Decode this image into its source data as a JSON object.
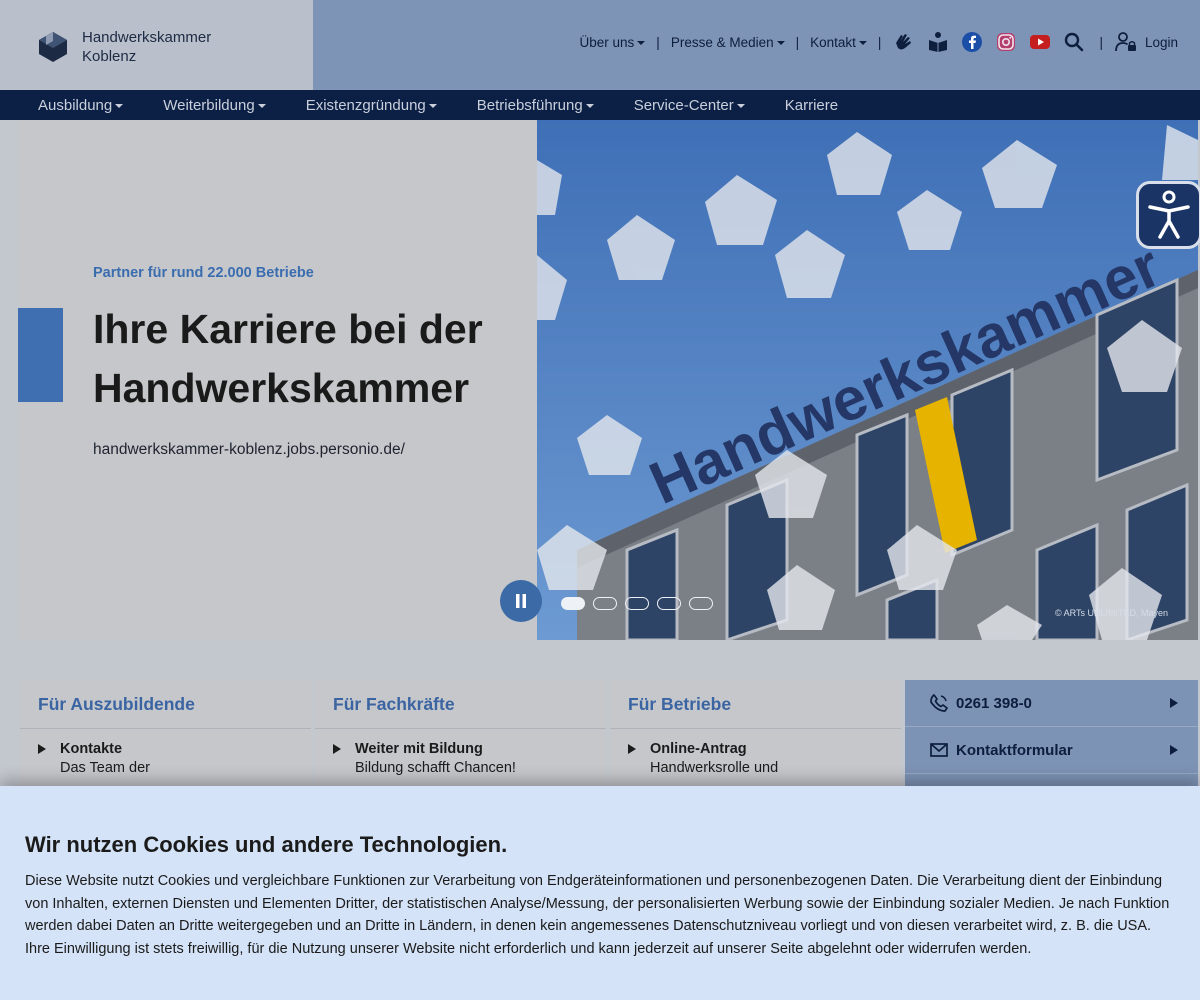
{
  "brand": {
    "name_line1": "Handwerkskammer",
    "name_line2": "Koblenz"
  },
  "meta_nav": {
    "items": [
      {
        "label": "Über uns"
      },
      {
        "label": "Presse & Medien"
      },
      {
        "label": "Kontakt"
      }
    ],
    "icons": [
      "sign-language-icon",
      "easy-language-icon",
      "facebook-icon",
      "instagram-icon",
      "youtube-icon",
      "search-icon"
    ],
    "login_label": "Login"
  },
  "main_nav": {
    "items": [
      {
        "label": "Ausbildung"
      },
      {
        "label": "Weiterbildung"
      },
      {
        "label": "Existenzgründung"
      },
      {
        "label": "Betriebsführung"
      },
      {
        "label": "Service-Center"
      },
      {
        "label": "Karriere"
      }
    ]
  },
  "hero": {
    "kicker": "Partner für rund 22.000 Betriebe",
    "headline": "Ihre Karriere bei der Handwerkskammer",
    "link": "handwerkskammer-koblenz.jobs.personio.de/",
    "image_sign_text": "Handwerkskammer",
    "copyright": "© ARTs UNLIMITED, Mayen",
    "slides_total": 5,
    "active_slide": 1
  },
  "cards": [
    {
      "title": "Für Auszubildende",
      "entry_title": "Kontakte",
      "entry_text": "Das Team der"
    },
    {
      "title": "Für Fachkräfte",
      "entry_title": "Weiter mit Bildung",
      "entry_text": "Bildung schafft Chancen!"
    },
    {
      "title": "Für Betriebe",
      "entry_title": "Online-Antrag",
      "entry_text": "Handwerksrolle und"
    }
  ],
  "contact": {
    "phone": "0261 398-0",
    "form_label": "Kontaktformular"
  },
  "cookie": {
    "title": "Wir nutzen Cookies und andere Technologien.",
    "text": "Diese Website nutzt Cookies und vergleichbare Funktionen zur Verarbeitung von Endgeräteinformationen und personenbezogenen Daten. Die Verarbeitung dient der Einbindung von Inhalten, externen Diensten und Elementen Dritter, der statistischen Analyse/Messung, der personalisierten Werbung sowie der Einbindung sozialer Medien. Je nach Funktion werden dabei Daten an Dritte weitergegeben und an Dritte in Ländern, in denen kein angemessenes Datenschutzniveau vorliegt und von diesen verarbeitet wird, z. B. die USA. Ihre Einwilligung ist stets freiwillig, für die Nutzung unserer Website nicht erforderlich und kann jederzeit auf unserer Seite abgelehnt oder widerrufen werden."
  },
  "colors": {
    "nav_bg": "#0c1f45",
    "accent": "#3f6fb0",
    "header_bg": "#7d94b6",
    "cookie_bg": "#d4e3f7"
  }
}
